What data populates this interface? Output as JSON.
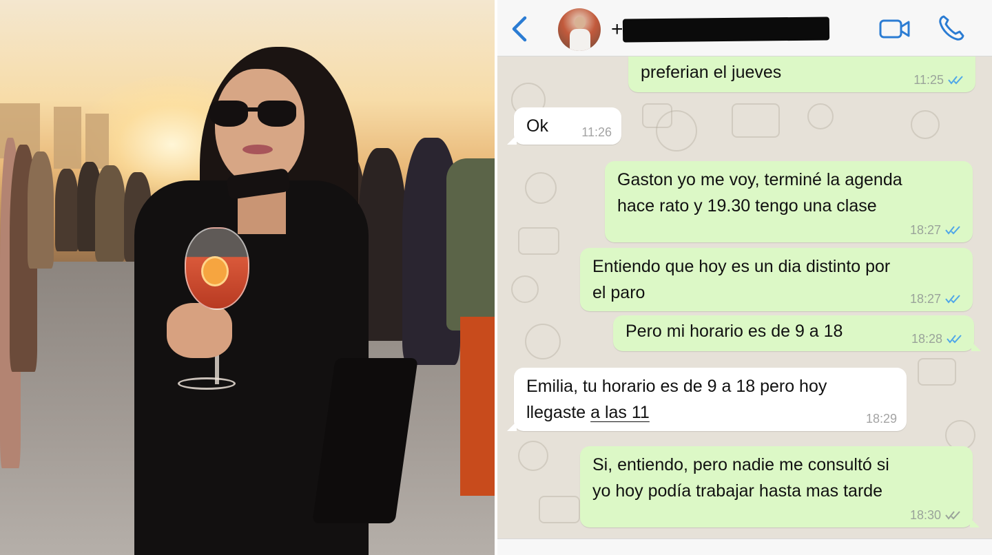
{
  "chat": {
    "contact_prefix": "+",
    "messages": [
      {
        "direction": "out",
        "text": "preferian el jueves",
        "time": "11:25",
        "status": "read"
      },
      {
        "direction": "in",
        "text": "Ok",
        "time": "11:26"
      },
      {
        "direction": "out",
        "text": "Gaston yo me voy, terminé la agenda\nhace rato y 19.30 tengo una clase",
        "time": "18:27",
        "status": "read"
      },
      {
        "direction": "out",
        "text": "Entiendo que hoy es un dia distinto por\nel paro",
        "time": "18:27",
        "status": "read"
      },
      {
        "direction": "out",
        "text": "Pero mi horario es de 9 a 18",
        "time": "18:28",
        "status": "read"
      },
      {
        "direction": "in",
        "text_line1": "Emilia, tu horario es de 9 a 18 pero hoy",
        "text_line2_a": "llegaste ",
        "text_line2_b": "a las 11",
        "time": "18:29"
      },
      {
        "direction": "out",
        "text": "Si, entiendo, pero nadie me consultó si\nyo hoy podía trabajar hasta mas tarde",
        "time": "18:30",
        "status": "delivered"
      }
    ]
  },
  "colors": {
    "outgoing_bubble": "#dcf8c6",
    "incoming_bubble": "#ffffff",
    "accent_blue": "#2b7cd3",
    "read_ticks": "#4fa6e8",
    "delivered_ticks": "#9aa39a",
    "chat_background": "#e6e1d8"
  },
  "icons": {
    "back": "chevron-left-icon",
    "video": "video-camera-icon",
    "call": "phone-icon",
    "read": "double-check-icon"
  }
}
